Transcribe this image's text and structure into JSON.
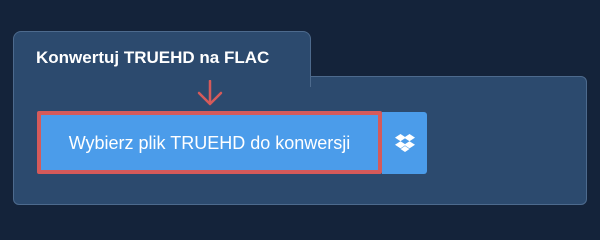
{
  "converter": {
    "title": "Konwertuj TRUEHD na FLAC",
    "upload_button_label": "Wybierz plik TRUEHD do konwersji",
    "dropbox_icon": "dropbox-icon",
    "arrow_icon": "arrow-down-icon"
  },
  "colors": {
    "background": "#14233a",
    "panel": "#2c4a6e",
    "button": "#4b9cea",
    "highlight": "#d55a5a"
  }
}
